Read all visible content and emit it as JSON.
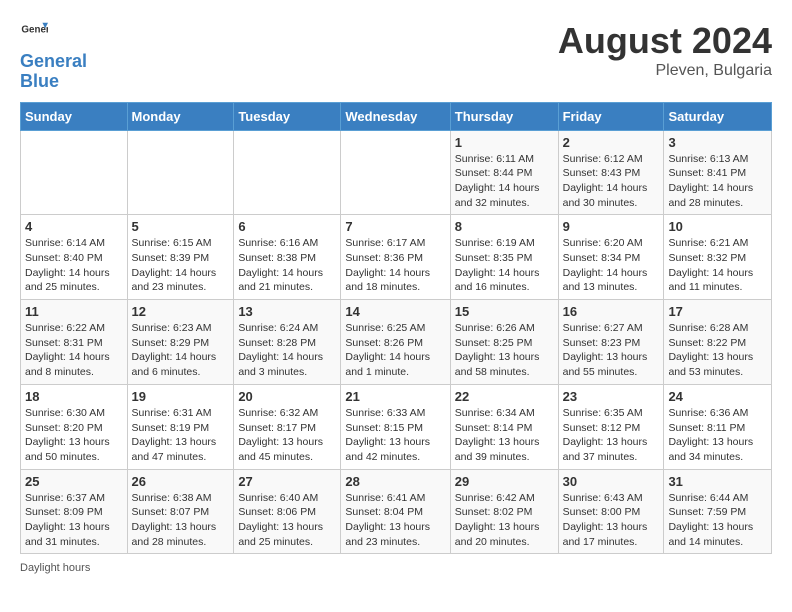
{
  "header": {
    "logo_general": "General",
    "logo_blue": "Blue",
    "month_year": "August 2024",
    "location": "Pleven, Bulgaria"
  },
  "days_of_week": [
    "Sunday",
    "Monday",
    "Tuesday",
    "Wednesday",
    "Thursday",
    "Friday",
    "Saturday"
  ],
  "weeks": [
    [
      {
        "day": "",
        "info": ""
      },
      {
        "day": "",
        "info": ""
      },
      {
        "day": "",
        "info": ""
      },
      {
        "day": "",
        "info": ""
      },
      {
        "day": "1",
        "info": "Sunrise: 6:11 AM\nSunset: 8:44 PM\nDaylight: 14 hours\nand 32 minutes."
      },
      {
        "day": "2",
        "info": "Sunrise: 6:12 AM\nSunset: 8:43 PM\nDaylight: 14 hours\nand 30 minutes."
      },
      {
        "day": "3",
        "info": "Sunrise: 6:13 AM\nSunset: 8:41 PM\nDaylight: 14 hours\nand 28 minutes."
      }
    ],
    [
      {
        "day": "4",
        "info": "Sunrise: 6:14 AM\nSunset: 8:40 PM\nDaylight: 14 hours\nand 25 minutes."
      },
      {
        "day": "5",
        "info": "Sunrise: 6:15 AM\nSunset: 8:39 PM\nDaylight: 14 hours\nand 23 minutes."
      },
      {
        "day": "6",
        "info": "Sunrise: 6:16 AM\nSunset: 8:38 PM\nDaylight: 14 hours\nand 21 minutes."
      },
      {
        "day": "7",
        "info": "Sunrise: 6:17 AM\nSunset: 8:36 PM\nDaylight: 14 hours\nand 18 minutes."
      },
      {
        "day": "8",
        "info": "Sunrise: 6:19 AM\nSunset: 8:35 PM\nDaylight: 14 hours\nand 16 minutes."
      },
      {
        "day": "9",
        "info": "Sunrise: 6:20 AM\nSunset: 8:34 PM\nDaylight: 14 hours\nand 13 minutes."
      },
      {
        "day": "10",
        "info": "Sunrise: 6:21 AM\nSunset: 8:32 PM\nDaylight: 14 hours\nand 11 minutes."
      }
    ],
    [
      {
        "day": "11",
        "info": "Sunrise: 6:22 AM\nSunset: 8:31 PM\nDaylight: 14 hours\nand 8 minutes."
      },
      {
        "day": "12",
        "info": "Sunrise: 6:23 AM\nSunset: 8:29 PM\nDaylight: 14 hours\nand 6 minutes."
      },
      {
        "day": "13",
        "info": "Sunrise: 6:24 AM\nSunset: 8:28 PM\nDaylight: 14 hours\nand 3 minutes."
      },
      {
        "day": "14",
        "info": "Sunrise: 6:25 AM\nSunset: 8:26 PM\nDaylight: 14 hours\nand 1 minute."
      },
      {
        "day": "15",
        "info": "Sunrise: 6:26 AM\nSunset: 8:25 PM\nDaylight: 13 hours\nand 58 minutes."
      },
      {
        "day": "16",
        "info": "Sunrise: 6:27 AM\nSunset: 8:23 PM\nDaylight: 13 hours\nand 55 minutes."
      },
      {
        "day": "17",
        "info": "Sunrise: 6:28 AM\nSunset: 8:22 PM\nDaylight: 13 hours\nand 53 minutes."
      }
    ],
    [
      {
        "day": "18",
        "info": "Sunrise: 6:30 AM\nSunset: 8:20 PM\nDaylight: 13 hours\nand 50 minutes."
      },
      {
        "day": "19",
        "info": "Sunrise: 6:31 AM\nSunset: 8:19 PM\nDaylight: 13 hours\nand 47 minutes."
      },
      {
        "day": "20",
        "info": "Sunrise: 6:32 AM\nSunset: 8:17 PM\nDaylight: 13 hours\nand 45 minutes."
      },
      {
        "day": "21",
        "info": "Sunrise: 6:33 AM\nSunset: 8:15 PM\nDaylight: 13 hours\nand 42 minutes."
      },
      {
        "day": "22",
        "info": "Sunrise: 6:34 AM\nSunset: 8:14 PM\nDaylight: 13 hours\nand 39 minutes."
      },
      {
        "day": "23",
        "info": "Sunrise: 6:35 AM\nSunset: 8:12 PM\nDaylight: 13 hours\nand 37 minutes."
      },
      {
        "day": "24",
        "info": "Sunrise: 6:36 AM\nSunset: 8:11 PM\nDaylight: 13 hours\nand 34 minutes."
      }
    ],
    [
      {
        "day": "25",
        "info": "Sunrise: 6:37 AM\nSunset: 8:09 PM\nDaylight: 13 hours\nand 31 minutes."
      },
      {
        "day": "26",
        "info": "Sunrise: 6:38 AM\nSunset: 8:07 PM\nDaylight: 13 hours\nand 28 minutes."
      },
      {
        "day": "27",
        "info": "Sunrise: 6:40 AM\nSunset: 8:06 PM\nDaylight: 13 hours\nand 25 minutes."
      },
      {
        "day": "28",
        "info": "Sunrise: 6:41 AM\nSunset: 8:04 PM\nDaylight: 13 hours\nand 23 minutes."
      },
      {
        "day": "29",
        "info": "Sunrise: 6:42 AM\nSunset: 8:02 PM\nDaylight: 13 hours\nand 20 minutes."
      },
      {
        "day": "30",
        "info": "Sunrise: 6:43 AM\nSunset: 8:00 PM\nDaylight: 13 hours\nand 17 minutes."
      },
      {
        "day": "31",
        "info": "Sunrise: 6:44 AM\nSunset: 7:59 PM\nDaylight: 13 hours\nand 14 minutes."
      }
    ]
  ],
  "footer": {
    "daylight_hours": "Daylight hours"
  }
}
